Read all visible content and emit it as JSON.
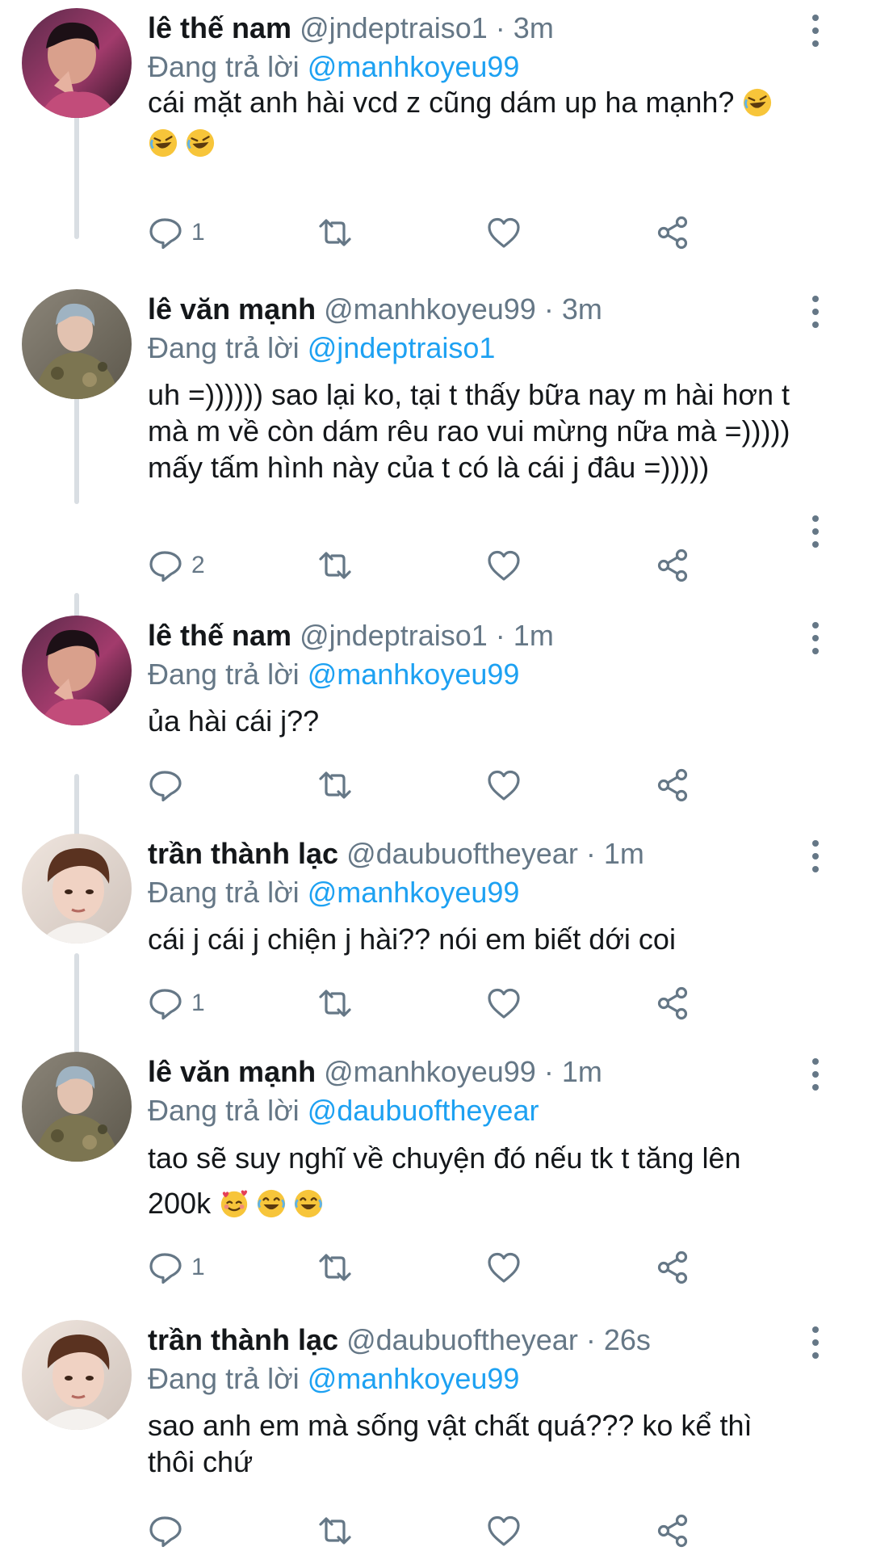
{
  "replying_prefix": "Đang trả lời",
  "tweets": [
    {
      "name": "lê thế nam",
      "handle": "@jndeptraiso1",
      "sep": "·",
      "time": "3m",
      "reply_to": "@manhkoyeu99",
      "text": "cái mặt anh hài vcd z cũng dám up ha mạnh?",
      "reply_count": "1",
      "avatar_icon": "profile-photo"
    },
    {
      "name": "lê văn mạnh",
      "handle": "@manhkoyeu99",
      "sep": "·",
      "time": "3m",
      "reply_to": "@jndeptraiso1",
      "text": "uh =)))))) sao lại ko, tại t thấy bữa nay m hài hơn t mà m về còn dám rêu rao vui mừng nữa mà =))))) mấy tấm hình này của t có là cái j đâu =)))))",
      "reply_count": "2",
      "avatar_icon": "profile-photo"
    },
    {
      "name": "lê thế nam",
      "handle": "@jndeptraiso1",
      "sep": "·",
      "time": "1m",
      "reply_to": "@manhkoyeu99",
      "text": "ủa hài cái j??",
      "reply_count": "",
      "avatar_icon": "profile-photo"
    },
    {
      "name": "trần thành lạc",
      "handle": "@daubuoftheyear",
      "sep": "·",
      "time": "1m",
      "reply_to": "@manhkoyeu99",
      "text": "cái j cái j chiện j hài?? nói em biết dới coi",
      "reply_count": "1",
      "avatar_icon": "profile-photo"
    },
    {
      "name": "lê văn mạnh",
      "handle": "@manhkoyeu99",
      "sep": "·",
      "time": "1m",
      "reply_to": "@daubuoftheyear",
      "text": "tao sẽ suy nghĩ về chuyện đó nếu tk t tăng lên",
      "text2": "200k",
      "reply_count": "1",
      "avatar_icon": "profile-photo"
    },
    {
      "name": "trần thành lạc",
      "handle": "@daubuoftheyear",
      "sep": "·",
      "time": "26s",
      "reply_to": "@manhkoyeu99",
      "text": "sao anh em mà sống vật chất quá??? ko kể thì thôi chứ",
      "reply_count": "",
      "avatar_icon": "profile-photo"
    }
  ],
  "colors": {
    "name": "#14171a",
    "meta": "#657786",
    "link": "#1da1f2",
    "thread_line": "#d9dee3"
  },
  "icons": {
    "reply": "reply-icon",
    "retweet": "retweet-icon",
    "like": "heart-icon",
    "share": "share-icon",
    "more": "more-vertical-icon",
    "emoji_rofl": "rolling-on-floor-laughing-emoji",
    "emoji_love": "smiling-face-with-hearts-emoji",
    "emoji_joy": "face-with-tears-of-joy-emoji"
  }
}
